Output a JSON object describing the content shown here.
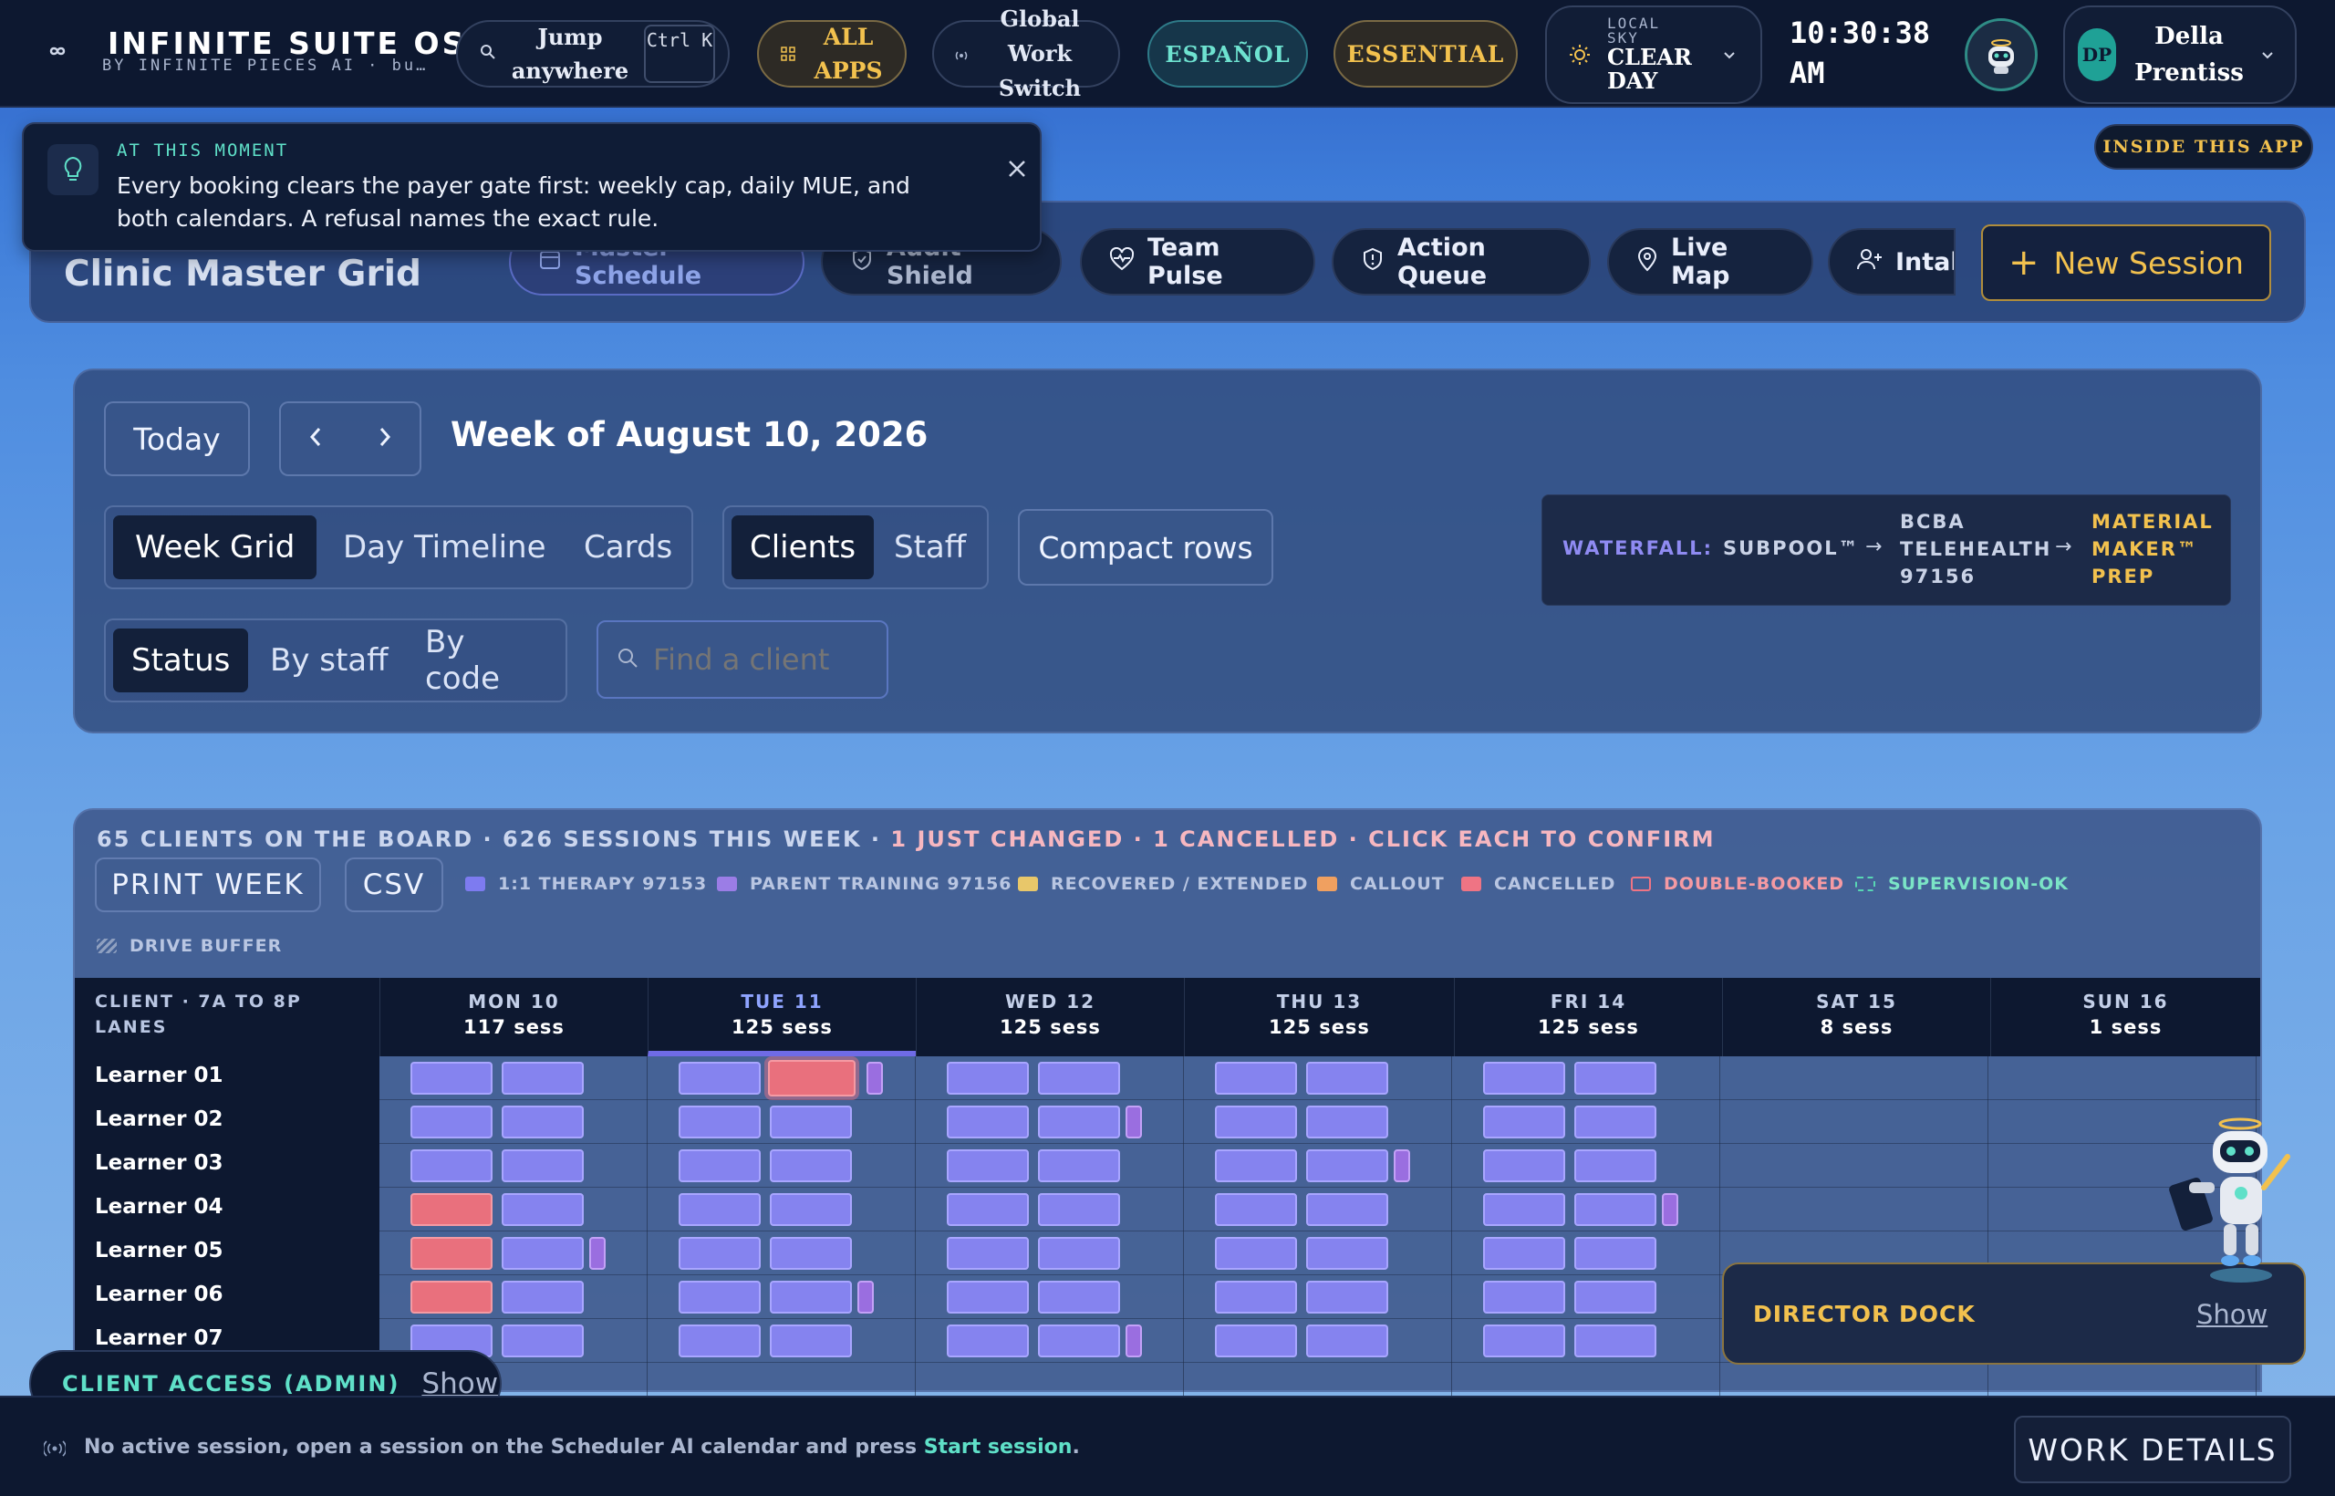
{
  "topbar": {
    "brand_title": "INFINITE SUITE OS",
    "brand_subtitle": "BY INFINITE PIECES AI · bu…",
    "jump_label": "Jump anywhere",
    "jump_shortcut": "Ctrl K",
    "all_apps": "ALL APPS",
    "global_switch": "Global Work Switch",
    "espanol": "ESPAÑOL",
    "essential": "ESSENTIAL",
    "weather_label": "LOCAL SKY",
    "weather_value": "CLEAR DAY",
    "time": "10:30:38 AM",
    "user_initials": "DP",
    "user_name": "Della Prentiss"
  },
  "toast": {
    "label": "AT THIS MOMENT",
    "text": "Every booking clears the payer gate first: weekly cap, daily MUE, and both calendars. A refusal names the exact rule."
  },
  "inside_app": "INSIDE THIS APP",
  "header": {
    "title": "Clinic Master Grid",
    "tabs": [
      "Master Schedule",
      "Audit Shield",
      "Team Pulse",
      "Action Queue",
      "Live Map",
      "Intak"
    ],
    "new_session": "New Session"
  },
  "controls": {
    "today": "Today",
    "week_title": "Week of August 10, 2026",
    "views": [
      "Week Grid",
      "Day Timeline",
      "Cards"
    ],
    "modes": [
      "Clients",
      "Staff"
    ],
    "compact": "Compact rows",
    "color_by": [
      "Status",
      "By staff",
      "By code"
    ],
    "search_placeholder": "Find a client",
    "waterfall_label": "WATERFALL:",
    "waterfall_a": "SUBPOOL™",
    "waterfall_b": "BCBA TELEHEALTH 97156",
    "waterfall_c": "MATERIAL MAKER™ PREP"
  },
  "board": {
    "summary_a": "65 CLIENTS ON THE BOARD · 626 SESSIONS THIS WEEK · ",
    "summary_b": "1 JUST CHANGED · 1 CANCELLED · CLICK EACH TO CONFIRM",
    "print": "PRINT WEEK",
    "csv": "CSV",
    "legend": [
      "1:1 THERAPY 97153",
      "PARENT TRAINING 97156",
      "RECOVERED / EXTENDED",
      "CALLOUT",
      "CANCELLED",
      "DOUBLE-BOOKED",
      "SUPERVISION-OK",
      "DRIVE BUFFER"
    ],
    "legend_colors": [
      "#7d7bf0",
      "#9b7de6",
      "#e8c76a",
      "#f0a060",
      "#ef7484",
      "#ef7484",
      "#58d6b4",
      "#8fa0c0"
    ],
    "corner_label": "CLIENT · 7A TO 8P LANES",
    "days": [
      {
        "name": "MON 10",
        "sess": "117 sess"
      },
      {
        "name": "TUE 11",
        "sess": "125 sess"
      },
      {
        "name": "WED 12",
        "sess": "125 sess"
      },
      {
        "name": "THU 13",
        "sess": "125 sess"
      },
      {
        "name": "FRI 14",
        "sess": "125 sess"
      },
      {
        "name": "SAT 15",
        "sess": "8 sess"
      },
      {
        "name": "SUN 16",
        "sess": "1 sess"
      }
    ],
    "learners": [
      "Learner 01",
      "Learner 02",
      "Learner 03",
      "Learner 04",
      "Learner 05",
      "Learner 06",
      "Learner 07"
    ]
  },
  "client_access": {
    "label": "CLIENT ACCESS (ADMIN)",
    "show": "Show"
  },
  "director_dock": {
    "label": "DIRECTOR DOCK",
    "show": "Show"
  },
  "footer": {
    "text": "No active session, open a session on the Scheduler AI calendar and press ",
    "link": "Start session",
    "end": ".",
    "work_details": "WORK DETAILS"
  },
  "colors": {
    "accent_gold": "#f2c14e",
    "accent_teal": "#5fe0c8",
    "topbar": "#0d1830",
    "session_blue": "#8583ef",
    "cancelled": "#e9707d"
  }
}
